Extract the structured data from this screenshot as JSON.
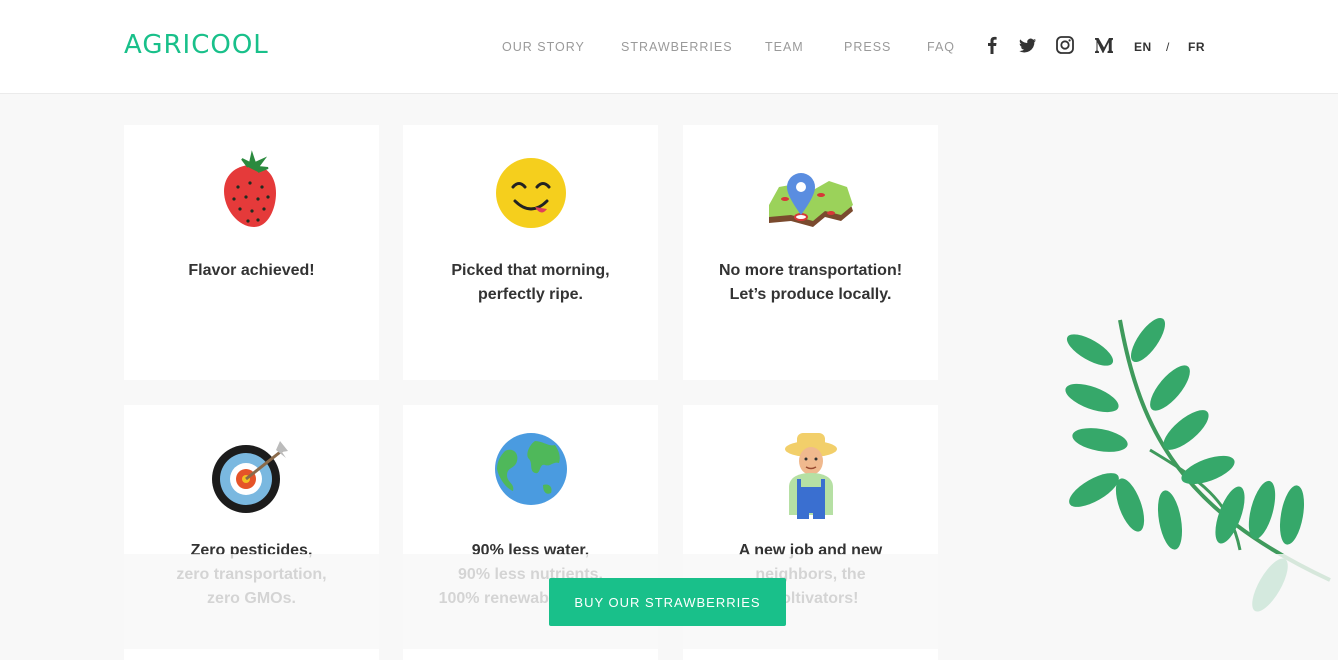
{
  "brand": {
    "logo_text": "AGRICOOL",
    "accent_color": "#19c08a"
  },
  "nav": {
    "items": [
      "OUR STORY",
      "STRAWBERRIES",
      "TEAM",
      "PRESS",
      "FAQ"
    ]
  },
  "social": [
    "facebook-icon",
    "twitter-icon",
    "instagram-icon",
    "medium-icon"
  ],
  "languages": {
    "en": "EN",
    "separator": "/",
    "fr": "FR"
  },
  "cards": [
    {
      "icon": "strawberry-icon",
      "text": "Flavor achieved!"
    },
    {
      "icon": "smiley-face-icon",
      "text": "Picked that morning,\nperfectly ripe."
    },
    {
      "icon": "map-pin-icon",
      "text": "No more transportation!\nLet’s produce locally."
    },
    {
      "icon": "target-icon",
      "text": "Zero pesticides,\nzero transportation,\nzero GMOs."
    },
    {
      "icon": "globe-icon",
      "text": "90% less water,\n90% less nutrients,\n100% renewable energy."
    },
    {
      "icon": "farmer-icon",
      "text": "A new job and new\nneighbors, the\ncooltivators!"
    }
  ],
  "cta": {
    "label": "BUY OUR STRAWBERRIES"
  }
}
